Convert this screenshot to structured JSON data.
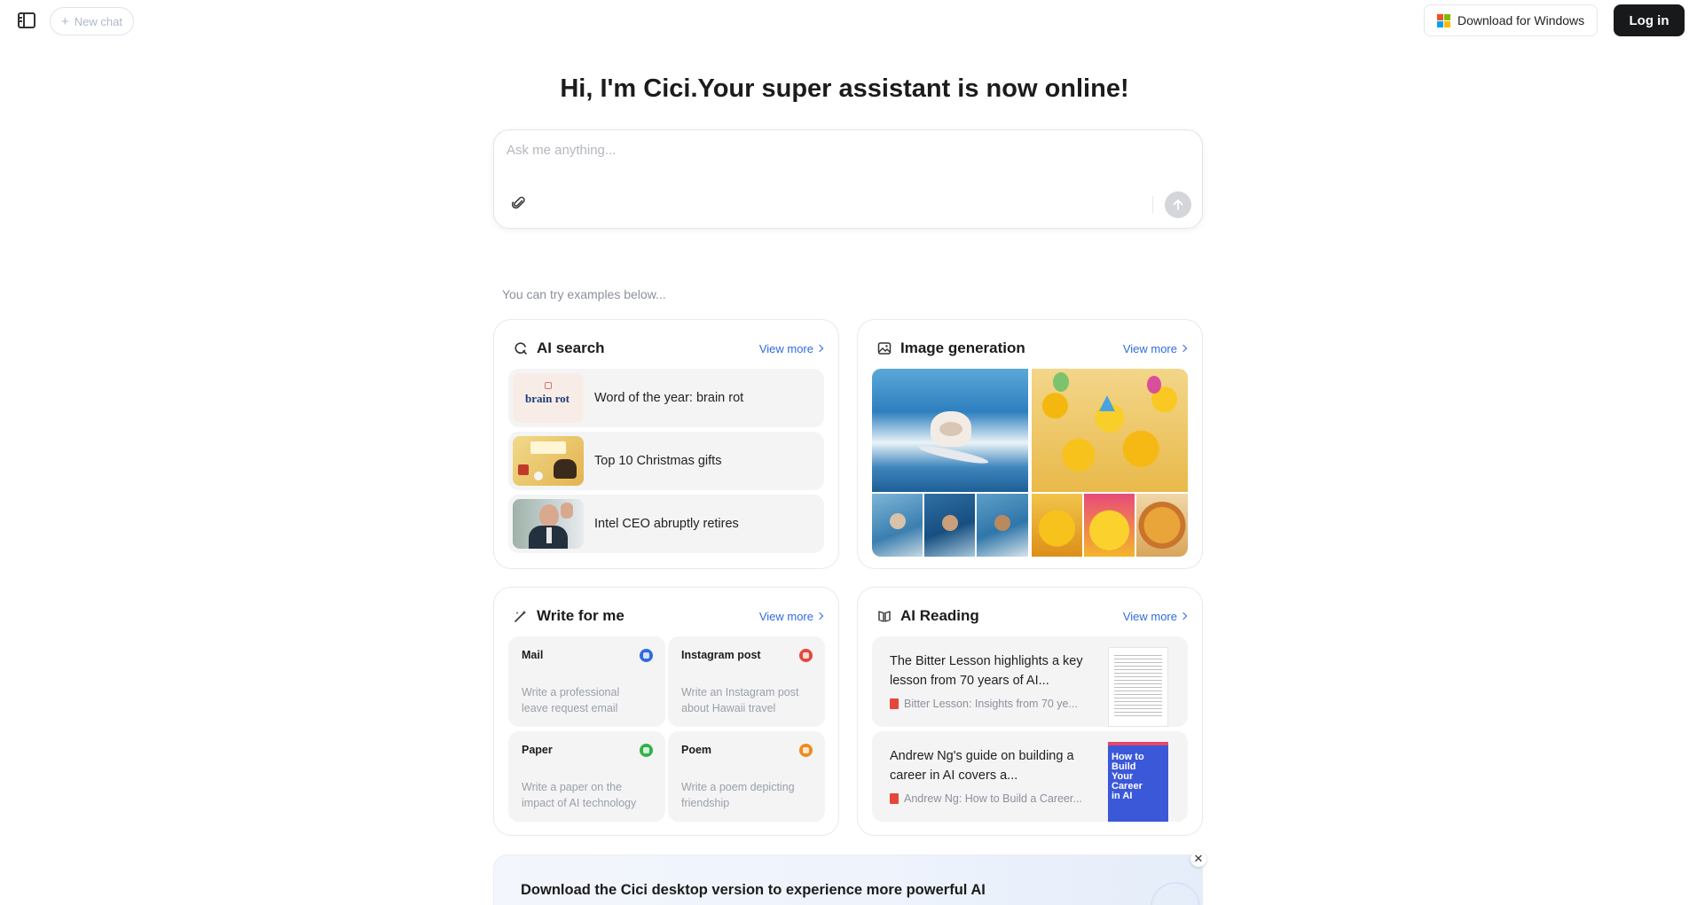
{
  "topbar": {
    "new_chat_label": "New chat",
    "download_label": "Download for Windows",
    "login_label": "Log in"
  },
  "hero": {
    "title": "Hi, I'm Cici.Your super assistant is now online!"
  },
  "chat": {
    "placeholder": "Ask me anything..."
  },
  "examples_hint": "You can try examples below...",
  "ai_search": {
    "title": "AI search",
    "view_more": "View more",
    "items": [
      {
        "label": "Word of the year: brain rot",
        "thumb_text": "brain rot"
      },
      {
        "label": "Top 10 Christmas gifts"
      },
      {
        "label": "Intel CEO abruptly retires"
      }
    ]
  },
  "image_generation": {
    "title": "Image generation",
    "view_more": "View more"
  },
  "write_for_me": {
    "title": "Write for me",
    "view_more": "View more",
    "tiles": [
      {
        "title": "Mail",
        "desc": "Write a professional leave request email",
        "color": "#2f6bde"
      },
      {
        "title": "Instagram post",
        "desc": "Write an Instagram post about Hawaii travel",
        "color": "#e5483a"
      },
      {
        "title": "Paper",
        "desc": "Write a paper on the impact of AI technology",
        "color": "#2fb24c"
      },
      {
        "title": "Poem",
        "desc": "Write a poem depicting friendship",
        "color": "#f08a1c"
      }
    ]
  },
  "ai_reading": {
    "title": "AI Reading",
    "view_more": "View more",
    "items": [
      {
        "text": "The Bitter Lesson highlights a key lesson from 70 years of AI...",
        "source": "Bitter Lesson: Insights from 70 ye..."
      },
      {
        "text": "Andrew Ng's guide on building a career in AI covers a...",
        "source": "Andrew Ng: How to Build a Career...",
        "cover_text": "How to Build Your Career in AI"
      }
    ]
  },
  "banner": {
    "text": "Download the Cici desktop version to experience more powerful AI capabilities"
  }
}
